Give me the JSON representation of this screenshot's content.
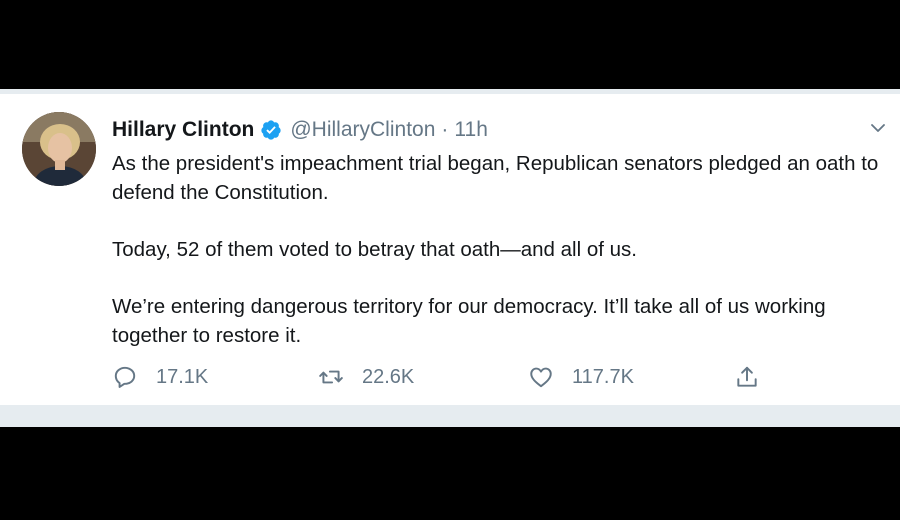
{
  "tweet": {
    "author": {
      "display_name": "Hillary Clinton",
      "handle": "@HillaryClinton",
      "verified": true
    },
    "separator": "·",
    "timestamp": "11h",
    "paragraphs": [
      "As the president's impeachment trial began, Republican senators pledged an oath to defend the Constitution.",
      "Today, 52 of them voted to betray that oath—and all of us.",
      "We’re entering dangerous territory for our democracy. It’ll take all of us working together to restore it."
    ],
    "actions": {
      "reply_count": "17.1K",
      "retweet_count": "22.6K",
      "like_count": "117.7K"
    }
  },
  "icons": {
    "verified": "verified-badge-icon",
    "caret": "chevron-down-icon",
    "reply": "reply-bubble-icon",
    "retweet": "retweet-icon",
    "like": "heart-icon",
    "share": "share-icon"
  },
  "colors": {
    "accent": "#1da1f2",
    "text_primary": "#14171a",
    "text_secondary": "#657786",
    "divider": "#e6ecf0"
  }
}
